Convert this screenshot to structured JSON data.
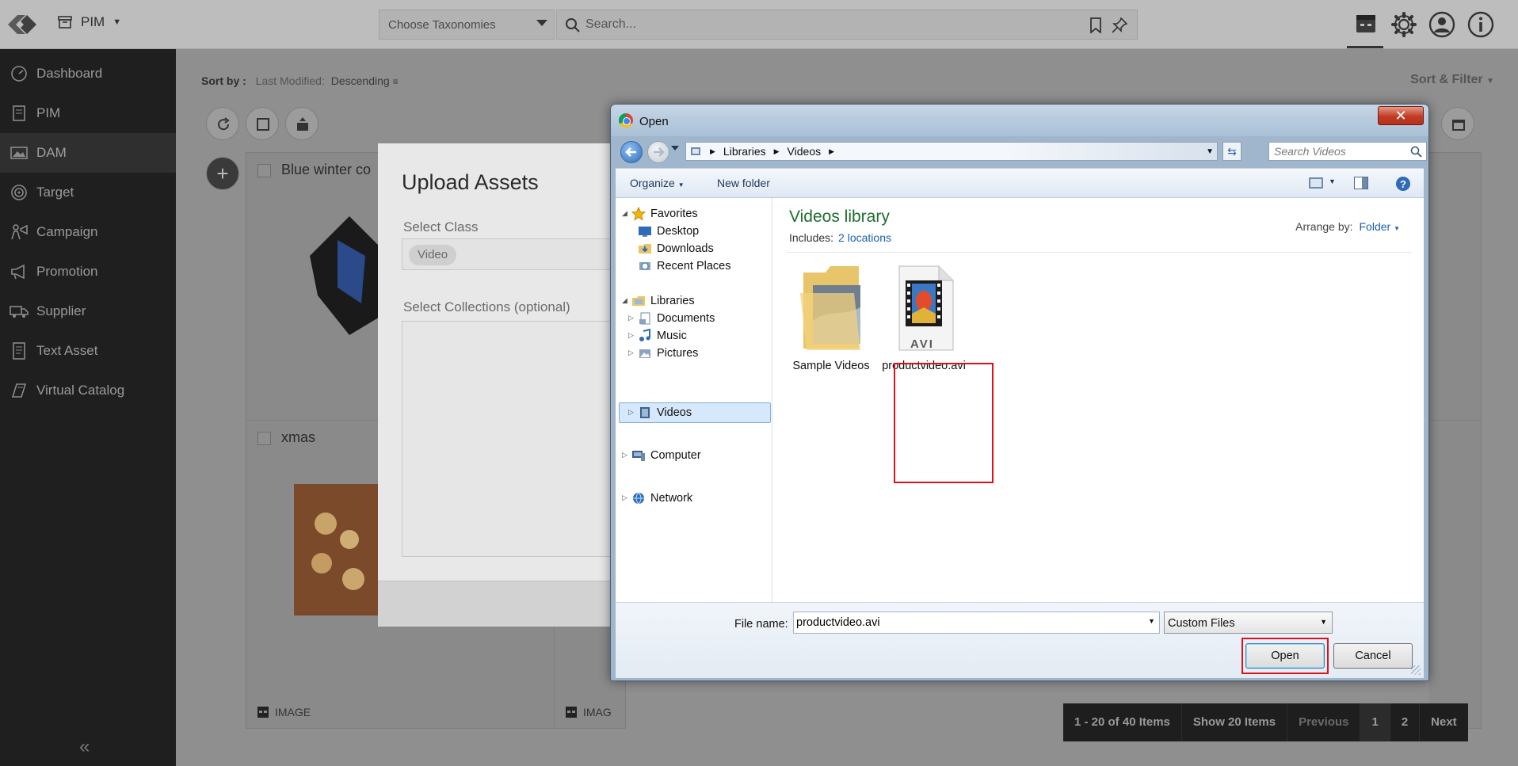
{
  "topbar": {
    "app_name": "PIM",
    "taxonomy_placeholder": "Choose Taxonomies",
    "search_placeholder": "Search..."
  },
  "sidebar": {
    "items": [
      {
        "label": "Dashboard",
        "icon": "dashboard-icon"
      },
      {
        "label": "PIM",
        "icon": "pim-icon"
      },
      {
        "label": "DAM",
        "icon": "image-icon",
        "active": true
      },
      {
        "label": "Target",
        "icon": "target-icon"
      },
      {
        "label": "Campaign",
        "icon": "campaign-icon"
      },
      {
        "label": "Promotion",
        "icon": "megaphone-icon"
      },
      {
        "label": "Supplier",
        "icon": "truck-icon"
      },
      {
        "label": "Text Asset",
        "icon": "document-icon"
      },
      {
        "label": "Virtual Catalog",
        "icon": "catalog-icon"
      }
    ],
    "collapse_glyph": "«"
  },
  "main": {
    "sort_label": "Sort by :",
    "sort_field": "Last Modified:",
    "sort_order": "Descending",
    "sort_filter": "Sort & Filter",
    "cards": [
      {
        "title": "Blue winter co",
        "type": "IMAGE"
      },
      {
        "title": "xmas",
        "type": "IMAGE"
      },
      {
        "title": "",
        "type": "IMAG"
      }
    ],
    "pager": {
      "range": "1 - 20 of 40 Items",
      "show": "Show 20 Items",
      "previous": "Previous",
      "page1": "1",
      "page2": "2",
      "next": "Next"
    }
  },
  "upload_modal": {
    "title": "Upload Assets",
    "select_class_label": "Select Class",
    "class_value": "Video",
    "collections_label": "Select Collections (optional)"
  },
  "open_dialog": {
    "title": "Open",
    "close_glyph": "✕",
    "breadcrumb": [
      "Libraries",
      "Videos"
    ],
    "search_placeholder": "Search Videos",
    "toolbar": {
      "organize": "Organize",
      "new_folder": "New folder"
    },
    "nav_tree": {
      "favorites": "Favorites",
      "desktop": "Desktop",
      "downloads": "Downloads",
      "recent": "Recent Places",
      "libraries": "Libraries",
      "documents": "Documents",
      "music": "Music",
      "pictures": "Pictures",
      "videos": "Videos",
      "computer": "Computer",
      "network": "Network"
    },
    "library_title": "Videos library",
    "includes_label": "Includes:",
    "includes_link": "2 locations",
    "arrange_label": "Arrange by:",
    "arrange_value": "Folder",
    "files": [
      {
        "name": "Sample Videos",
        "kind": "folder"
      },
      {
        "name": "productvideo.avi",
        "kind": "avi",
        "selected": true,
        "badge": "AVI"
      }
    ],
    "file_name_label": "File name:",
    "file_name_value": "productvideo.avi",
    "file_type": "Custom Files",
    "open_label": "Open",
    "cancel_label": "Cancel"
  }
}
